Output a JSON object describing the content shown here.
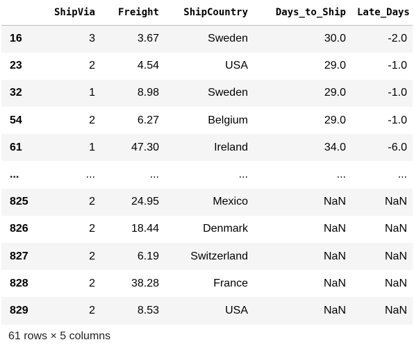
{
  "table": {
    "columns": [
      "",
      "ShipVia",
      "Freight",
      "ShipCountry",
      "Days_to_Ship",
      "Late_Days"
    ],
    "rows": [
      {
        "index": "16",
        "cells": [
          "3",
          "3.67",
          "Sweden",
          "30.0",
          "-2.0"
        ]
      },
      {
        "index": "23",
        "cells": [
          "2",
          "4.54",
          "USA",
          "29.0",
          "-1.0"
        ]
      },
      {
        "index": "32",
        "cells": [
          "1",
          "8.98",
          "Sweden",
          "29.0",
          "-1.0"
        ]
      },
      {
        "index": "54",
        "cells": [
          "2",
          "6.27",
          "Belgium",
          "29.0",
          "-1.0"
        ]
      },
      {
        "index": "61",
        "cells": [
          "1",
          "47.30",
          "Ireland",
          "34.0",
          "-6.0"
        ]
      },
      {
        "index": "...",
        "cells": [
          "...",
          "...",
          "...",
          "...",
          "..."
        ]
      },
      {
        "index": "825",
        "cells": [
          "2",
          "24.95",
          "Mexico",
          "NaN",
          "NaN"
        ]
      },
      {
        "index": "826",
        "cells": [
          "2",
          "18.44",
          "Denmark",
          "NaN",
          "NaN"
        ]
      },
      {
        "index": "827",
        "cells": [
          "2",
          "6.19",
          "Switzerland",
          "NaN",
          "NaN"
        ]
      },
      {
        "index": "828",
        "cells": [
          "2",
          "38.28",
          "France",
          "NaN",
          "NaN"
        ]
      },
      {
        "index": "829",
        "cells": [
          "2",
          "8.53",
          "USA",
          "NaN",
          "NaN"
        ]
      }
    ]
  },
  "footer": {
    "summary": "61 rows × 5 columns"
  },
  "colors": {
    "stripe": "#f5f5f5",
    "header_border": "#bdbdbd"
  }
}
